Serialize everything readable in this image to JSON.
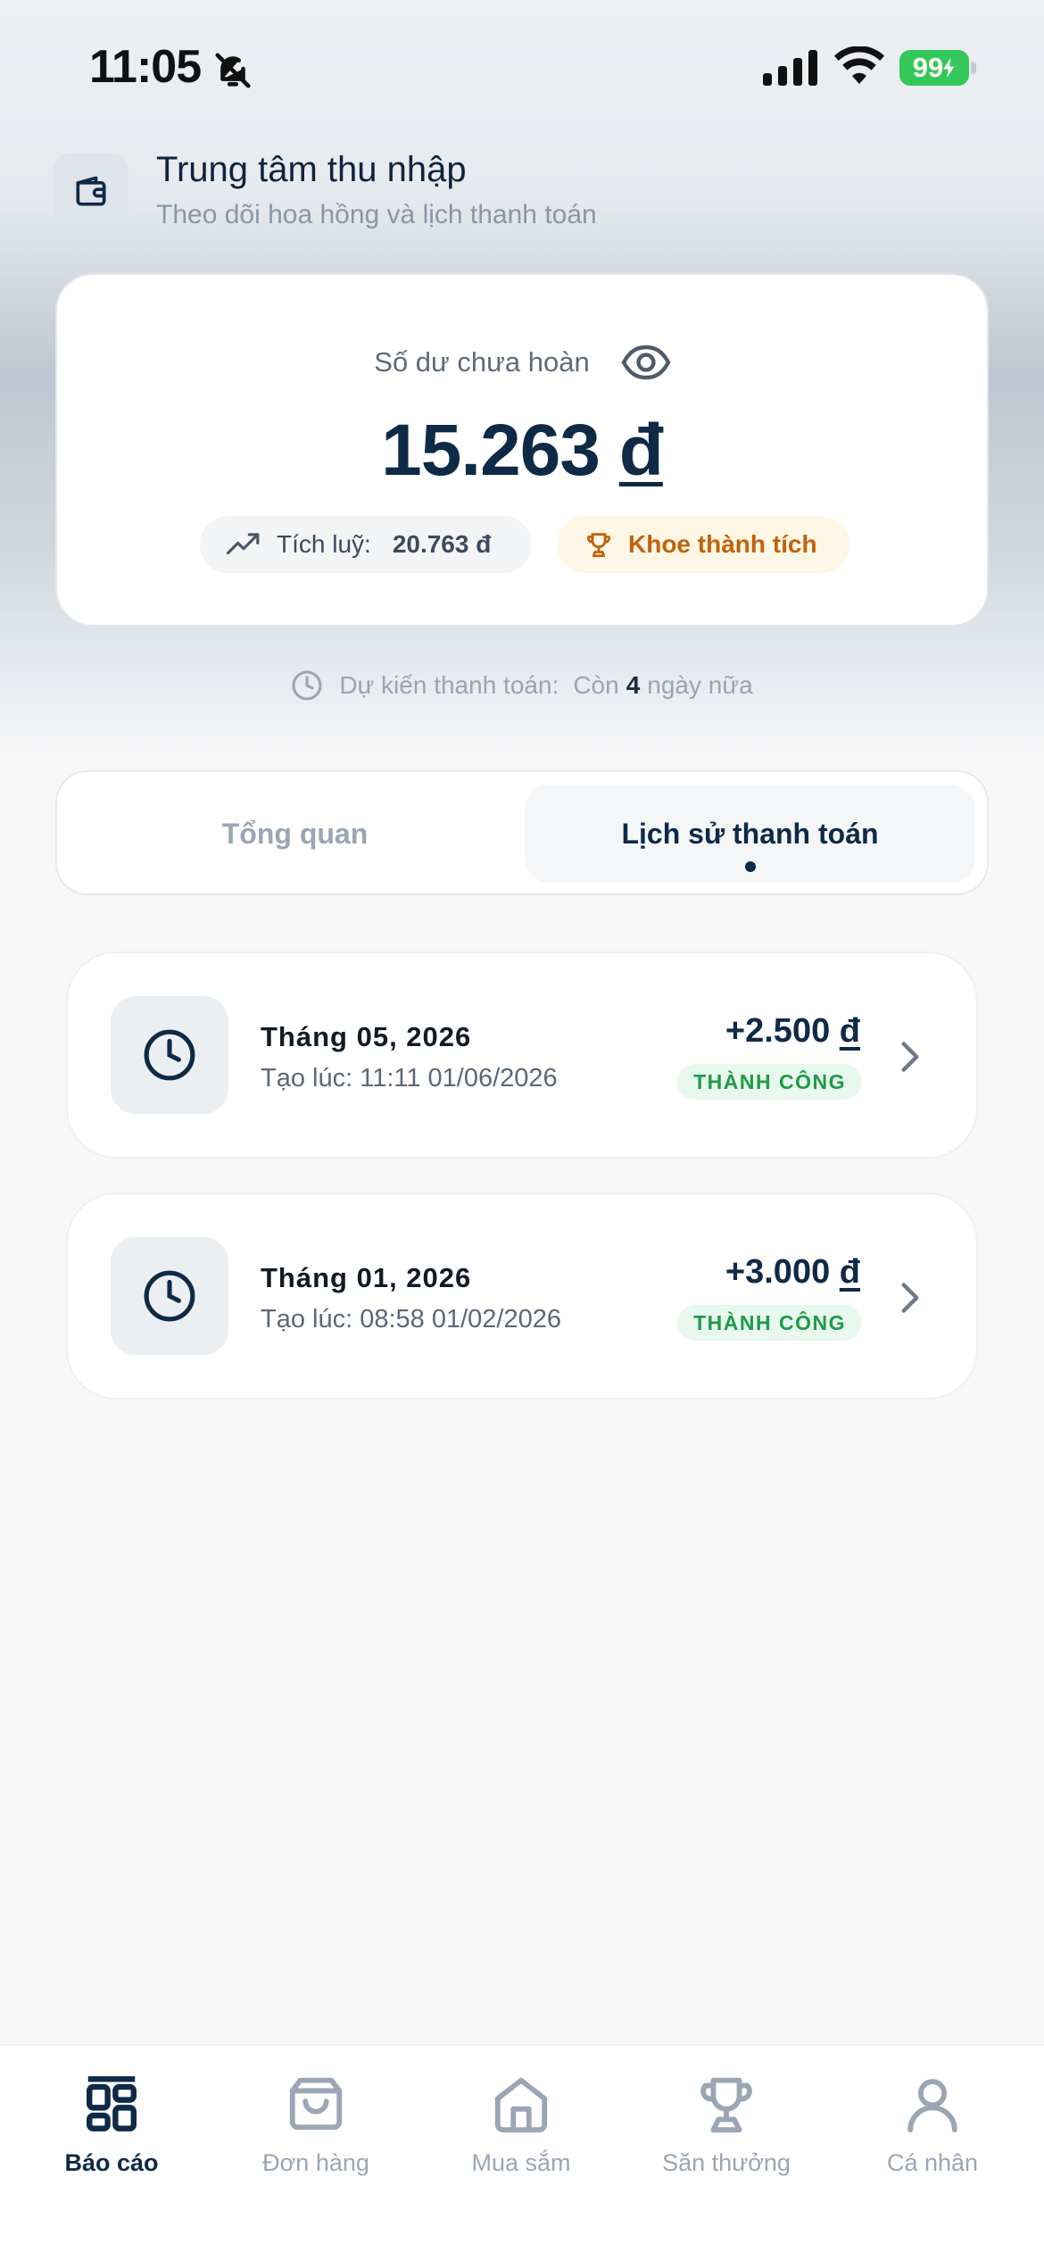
{
  "status_bar": {
    "time": "11:05",
    "battery": "99",
    "icons": [
      "bell-off-icon",
      "signal-icon",
      "wifi-icon",
      "battery-icon"
    ]
  },
  "header": {
    "icon": "wallet-icon",
    "title": "Trung tâm thu nhập",
    "subtitle": "Theo dõi hoa hồng và lịch thanh toán"
  },
  "balance": {
    "label": "Số dư chưa hoàn",
    "amount": "15.263",
    "currency": "đ",
    "accumulated_label": "Tích luỹ:",
    "accumulated_value": "20.763 đ",
    "show_off_label": "Khoe thành tích"
  },
  "payout_note": {
    "prefix": "Dự kiến thanh toán:",
    "remaining_prefix": "Còn",
    "days": "4",
    "suffix": "ngày nữa"
  },
  "tabs": [
    {
      "label": "Tổng quan",
      "active": false
    },
    {
      "label": "Lịch sử thanh toán",
      "active": true
    }
  ],
  "payments": [
    {
      "title": "Tháng 05, 2026",
      "created": "Tạo lúc: 11:11 01/06/2026",
      "amount": "+2.500",
      "currency": "đ",
      "status": "THÀNH CÔNG"
    },
    {
      "title": "Tháng 01, 2026",
      "created": "Tạo lúc: 08:58 01/02/2026",
      "amount": "+3.000",
      "currency": "đ",
      "status": "THÀNH CÔNG"
    }
  ],
  "bottom_nav": [
    {
      "label": "Báo cáo",
      "icon": "dashboard-icon",
      "active": true
    },
    {
      "label": "Đơn hàng",
      "icon": "bag-icon",
      "active": false
    },
    {
      "label": "Mua sắm",
      "icon": "home-icon",
      "active": false
    },
    {
      "label": "Săn thưởng",
      "icon": "trophy-icon",
      "active": false
    },
    {
      "label": "Cá nhân",
      "icon": "user-icon",
      "active": false
    }
  ],
  "colors": {
    "primary": "#0e2a47",
    "success": "#1d9b48",
    "success_bg": "#e9f8ee",
    "accent_orange": "#c2620b",
    "battery": "#34c759"
  }
}
